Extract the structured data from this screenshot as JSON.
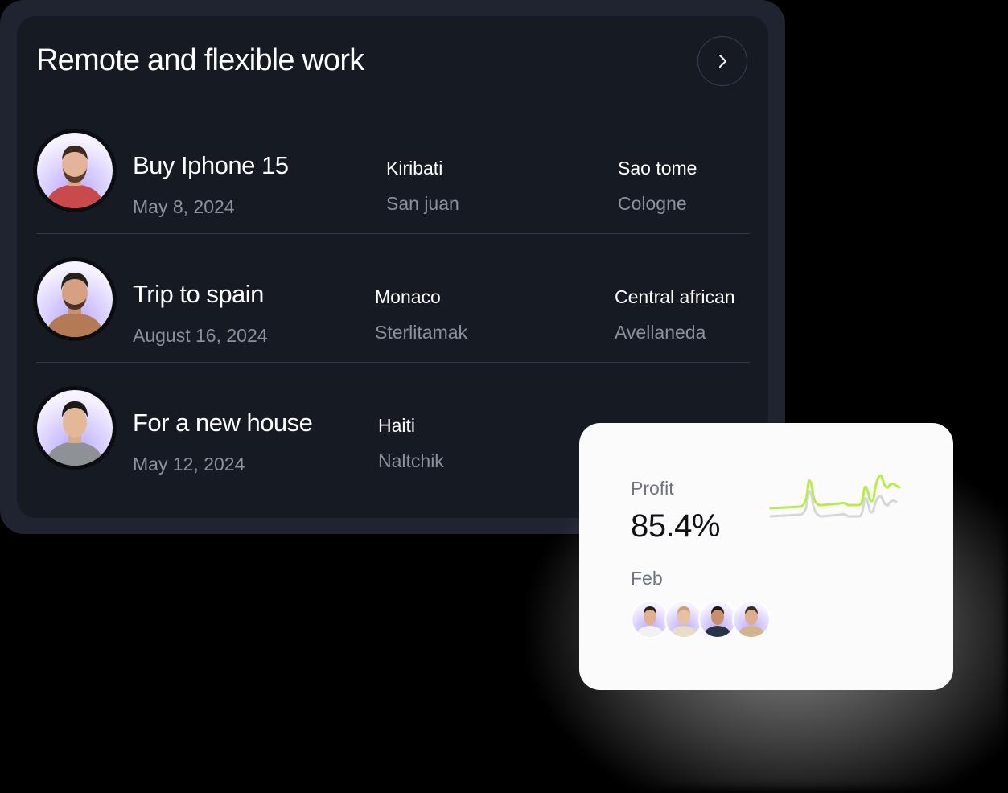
{
  "card": {
    "title": "Remote and flexible work",
    "next_icon": "chevron-right-icon"
  },
  "rows": [
    {
      "title": "Buy Iphone 15",
      "date": "May 8, 2024",
      "col1_top": "Kiribati",
      "col1_bottom": "San juan",
      "col2_top": "Sao tome",
      "col2_bottom": "Cologne",
      "shirt_color": "#c94a4a"
    },
    {
      "title": "Trip to spain",
      "date": "August 16, 2024",
      "col1_top": "Monaco",
      "col1_bottom": "Sterlitamak",
      "col2_top": "Central african",
      "col2_bottom": "Avellaneda",
      "shirt_color": "#b47a56"
    },
    {
      "title": "For a new house",
      "date": "May 12, 2024",
      "col1_top": "Haiti",
      "col1_bottom": "Naltchik",
      "col2_top": "",
      "col2_bottom": "",
      "shirt_color": "#8e9196"
    }
  ],
  "stats": {
    "profit_label": "Profit",
    "profit_value": "85.4%",
    "month": "Feb",
    "accent": "#b8ec4c",
    "shadow_line": "#d4d6da",
    "avatars": [
      {
        "shirt": "#f2f2f2",
        "hair": "#2a2220"
      },
      {
        "shirt": "#e9ddc8",
        "hair": "#c9a070"
      },
      {
        "shirt": "#283447",
        "hair": "#1d1714"
      },
      {
        "shirt": "#d2b48a",
        "hair": "#3a2a20"
      }
    ]
  }
}
